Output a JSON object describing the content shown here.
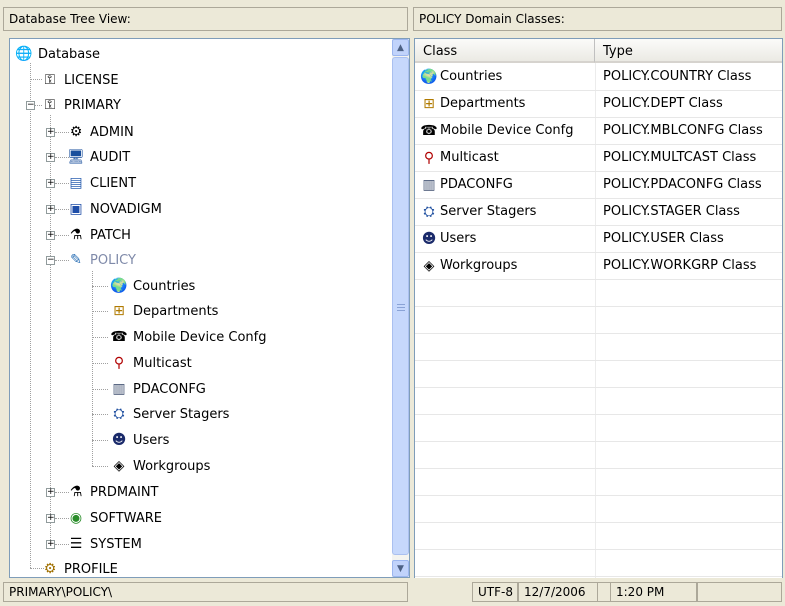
{
  "tree_pane": {
    "title": "Database Tree View:",
    "root_label": "Database",
    "nodes": [
      {
        "label": "LICENSE"
      },
      {
        "label": "PRIMARY"
      },
      {
        "label": "ADMIN"
      },
      {
        "label": "AUDIT"
      },
      {
        "label": "CLIENT"
      },
      {
        "label": "NOVADIGM"
      },
      {
        "label": "PATCH"
      },
      {
        "label": "POLICY"
      },
      {
        "label": "Countries"
      },
      {
        "label": "Departments"
      },
      {
        "label": "Mobile Device Confg"
      },
      {
        "label": "Multicast"
      },
      {
        "label": "PDACONFG"
      },
      {
        "label": "Server Stagers"
      },
      {
        "label": "Users"
      },
      {
        "label": "Workgroups"
      },
      {
        "label": "PRDMAINT"
      },
      {
        "label": "SOFTWARE"
      },
      {
        "label": "SYSTEM"
      },
      {
        "label": "PROFILE"
      }
    ],
    "expander_plus": "+",
    "expander_minus": "−"
  },
  "grid_pane": {
    "title": "POLICY Domain Classes:",
    "columns": [
      "Class",
      "Type"
    ],
    "rows": [
      {
        "cls": "Countries",
        "type": "POLICY.COUNTRY Class"
      },
      {
        "cls": "Departments",
        "type": "POLICY.DEPT Class"
      },
      {
        "cls": "Mobile Device Confg",
        "type": "POLICY.MBLCONFG Class"
      },
      {
        "cls": "Multicast",
        "type": "POLICY.MULTCAST Class"
      },
      {
        "cls": "PDACONFG",
        "type": "POLICY.PDACONFG Class"
      },
      {
        "cls": "Server Stagers",
        "type": "POLICY.STAGER Class"
      },
      {
        "cls": "Users",
        "type": "POLICY.USER Class"
      },
      {
        "cls": "Workgroups",
        "type": "POLICY.WORKGRP Class"
      }
    ]
  },
  "statusbar": {
    "path": "PRIMARY\\POLICY\\",
    "encoding": "UTF-8",
    "date": "12/7/2006",
    "time": "1:20 PM"
  },
  "icons": {
    "database": "🌐",
    "license": "⚿",
    "primary": "⚿",
    "admin": "⚙",
    "audit": "🖥",
    "client": "▤",
    "novadigm": "▣",
    "patch": "⚗",
    "policy": "✎",
    "countries": "🌍",
    "departments": "⊞",
    "mobile": "☎",
    "multicast": "⚲",
    "pdaconfg": "▥",
    "stagers": "⛭",
    "users": "☻",
    "workgroups": "◈",
    "prdmaint": "⚗",
    "software": "◉",
    "system": "☰",
    "profile": "⚙",
    "scroll_up": "▲",
    "scroll_down": "▼"
  }
}
